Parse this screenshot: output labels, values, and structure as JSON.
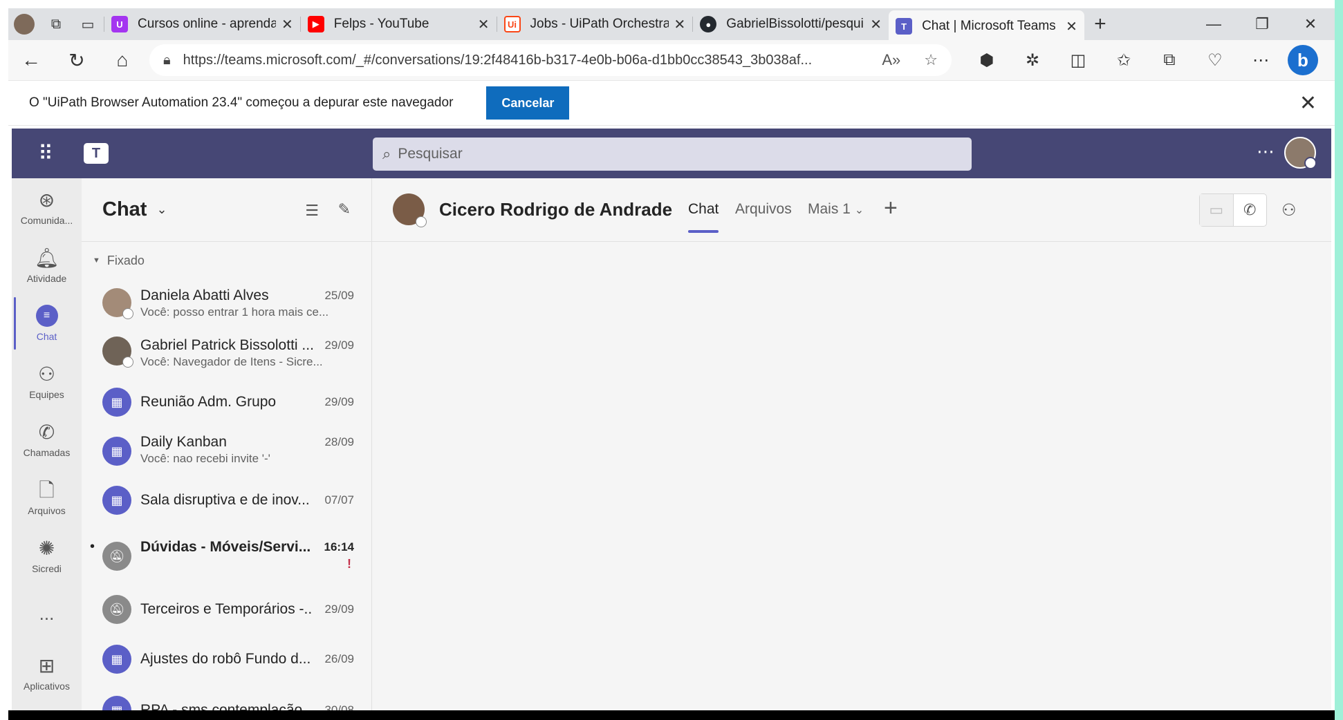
{
  "browser": {
    "tabs": [
      {
        "title": "Cursos online - aprenda",
        "favicon": "udemy-icon",
        "color": "#a435f0"
      },
      {
        "title": "Felps - YouTube",
        "favicon": "youtube-icon",
        "color": "#ff0000"
      },
      {
        "title": "Jobs - UiPath Orchestrato",
        "favicon": "uipath-icon",
        "color": "#fa4616"
      },
      {
        "title": "GabrielBissolotti/pesqui",
        "favicon": "github-icon",
        "color": "#24292f"
      },
      {
        "title": "Chat | Microsoft Teams",
        "favicon": "teams-icon",
        "color": "#5b5fc7"
      }
    ],
    "url": "https://teams.microsoft.com/_#/conversations/19:2f48416b-b317-4e0b-b06a-d1bb0cc38543_3b038af..."
  },
  "infobar": {
    "message": "O \"UiPath Browser Automation 23.4\" começou a depurar este navegador",
    "cancel_label": "Cancelar"
  },
  "teams": {
    "search_placeholder": "Pesquisar",
    "rail": [
      {
        "label": "Comunida...",
        "icon": "communities-icon"
      },
      {
        "label": "Atividade",
        "icon": "bell-icon"
      },
      {
        "label": "Chat",
        "icon": "chat-icon"
      },
      {
        "label": "Equipes",
        "icon": "teams-icon"
      },
      {
        "label": "Chamadas",
        "icon": "phone-icon"
      },
      {
        "label": "Arquivos",
        "icon": "file-icon"
      },
      {
        "label": "Sicredi",
        "icon": "sicredi-icon"
      },
      {
        "label": "...",
        "icon": "more-icon"
      },
      {
        "label": "Aplicativos",
        "icon": "apps-icon"
      }
    ],
    "chat_list": {
      "title": "Chat",
      "pinned_label": "Fixado",
      "items": [
        {
          "name": "Daniela Abatti Alves",
          "preview": "Você: posso entrar 1 hora mais ce...",
          "date": "25/09"
        },
        {
          "name": "Gabriel Patrick Bissolotti ...",
          "preview": "Você: Navegador de Itens - Sicre...",
          "date": "29/09"
        },
        {
          "name": "Reunião Adm. Grupo",
          "preview": "",
          "date": "29/09"
        },
        {
          "name": "Daily Kanban",
          "preview": "Você: nao recebi invite '-'",
          "date": "28/09"
        },
        {
          "name": "Sala disruptiva e de inov...",
          "preview": "",
          "date": "07/07"
        },
        {
          "name": "Dúvidas - Móveis/Servi...",
          "preview": "",
          "date": "16:14",
          "unread": "•",
          "important": "!"
        },
        {
          "name": "Terceiros e Temporários -...",
          "preview": "",
          "date": "29/09"
        },
        {
          "name": "Ajustes do robô Fundo d...",
          "preview": "",
          "date": "26/09"
        },
        {
          "name": "RPA - sms contemplação",
          "preview": "",
          "date": "30/08"
        }
      ]
    },
    "conversation": {
      "name": "Cicero Rodrigo de Andrade",
      "tabs": [
        "Chat",
        "Arquivos",
        "Mais 1"
      ],
      "accent": "#5b5fc7"
    }
  }
}
